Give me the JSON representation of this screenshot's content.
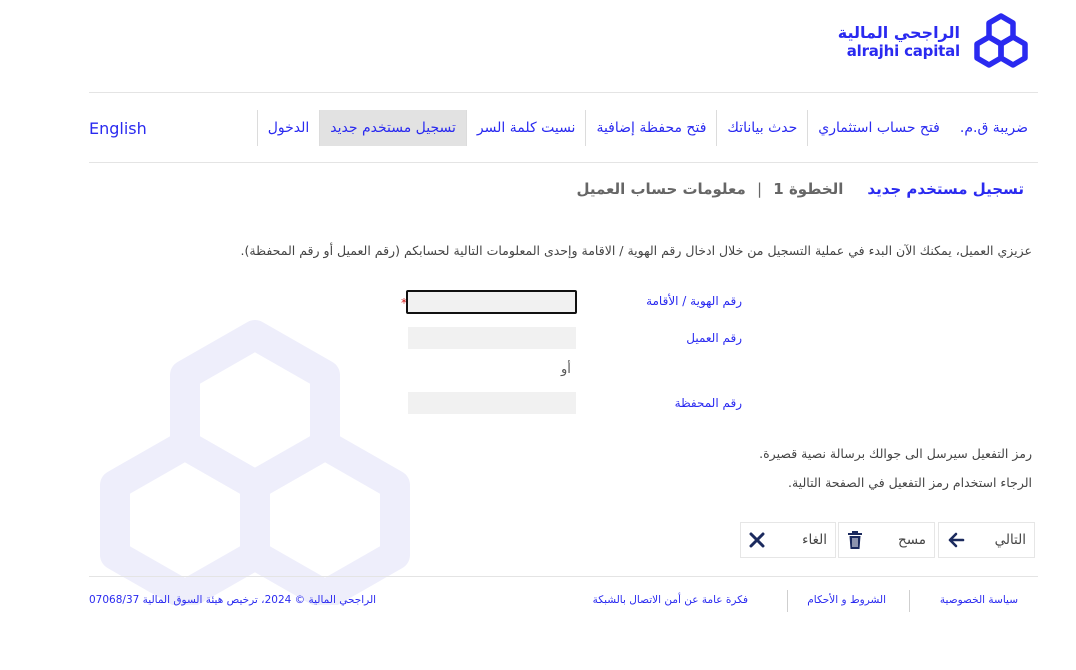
{
  "brand": {
    "name_ar": "الراجحي المالية",
    "name_en": "alrajhi capital",
    "color": "#2a2af0"
  },
  "nav": {
    "items": [
      {
        "label": "الدخول",
        "active": false
      },
      {
        "label": "تسجيل مستخدم جديد",
        "active": true
      },
      {
        "label": "نسيت كلمة السر",
        "active": false
      },
      {
        "label": "فتح محفظة إضافية",
        "active": false
      },
      {
        "label": "حدث بياناتك",
        "active": false
      },
      {
        "label": "فتح حساب استثماري",
        "active": false
      },
      {
        "label": "ضريبة ق.م.",
        "active": false
      }
    ],
    "language": "English"
  },
  "step": {
    "title": "تسجيل مستخدم جديد",
    "step_label": "الخطوة 1",
    "separator": "|",
    "info": "معلومات حساب العميل"
  },
  "intro": "عزيزي العميل، يمكنك الآن البدء في عملية التسجيل من خلال ادخال رقم الهوية / الاقامة وإحدى المعلومات التالية لحسابكم (رقم العميل أو رقم المحفظة).",
  "form": {
    "id_label": "رقم الهوية / الأقامة",
    "id_value": "",
    "required_mark": "*",
    "customer_label": "رقم العميل",
    "customer_value": "",
    "or_text": "أو",
    "portfolio_label": "رقم المحفظة",
    "portfolio_value": ""
  },
  "notes": {
    "line1": "رمز التفعيل سيرسل الى جوالك برسالة نصية قصيرة.",
    "line2": "الرجاء استخدام رمز التفعيل في الصفحة التالية."
  },
  "buttons": {
    "next": "التالي",
    "clear": "مسح",
    "cancel": "الغاء"
  },
  "footer": {
    "privacy": "سياسة الخصوصية",
    "terms": "الشروط و الأحكام",
    "security": "فكرة عامة عن أمن الاتصال بالشبكة",
    "copyright": "الراجحي المالية © 2024، ترخيص هيئة السوق المالية 07068/37"
  },
  "icons": {
    "logo": "hexagon-chain-logo-icon",
    "next": "arrow-left-icon",
    "clear": "trash-icon",
    "cancel": "close-icon"
  }
}
